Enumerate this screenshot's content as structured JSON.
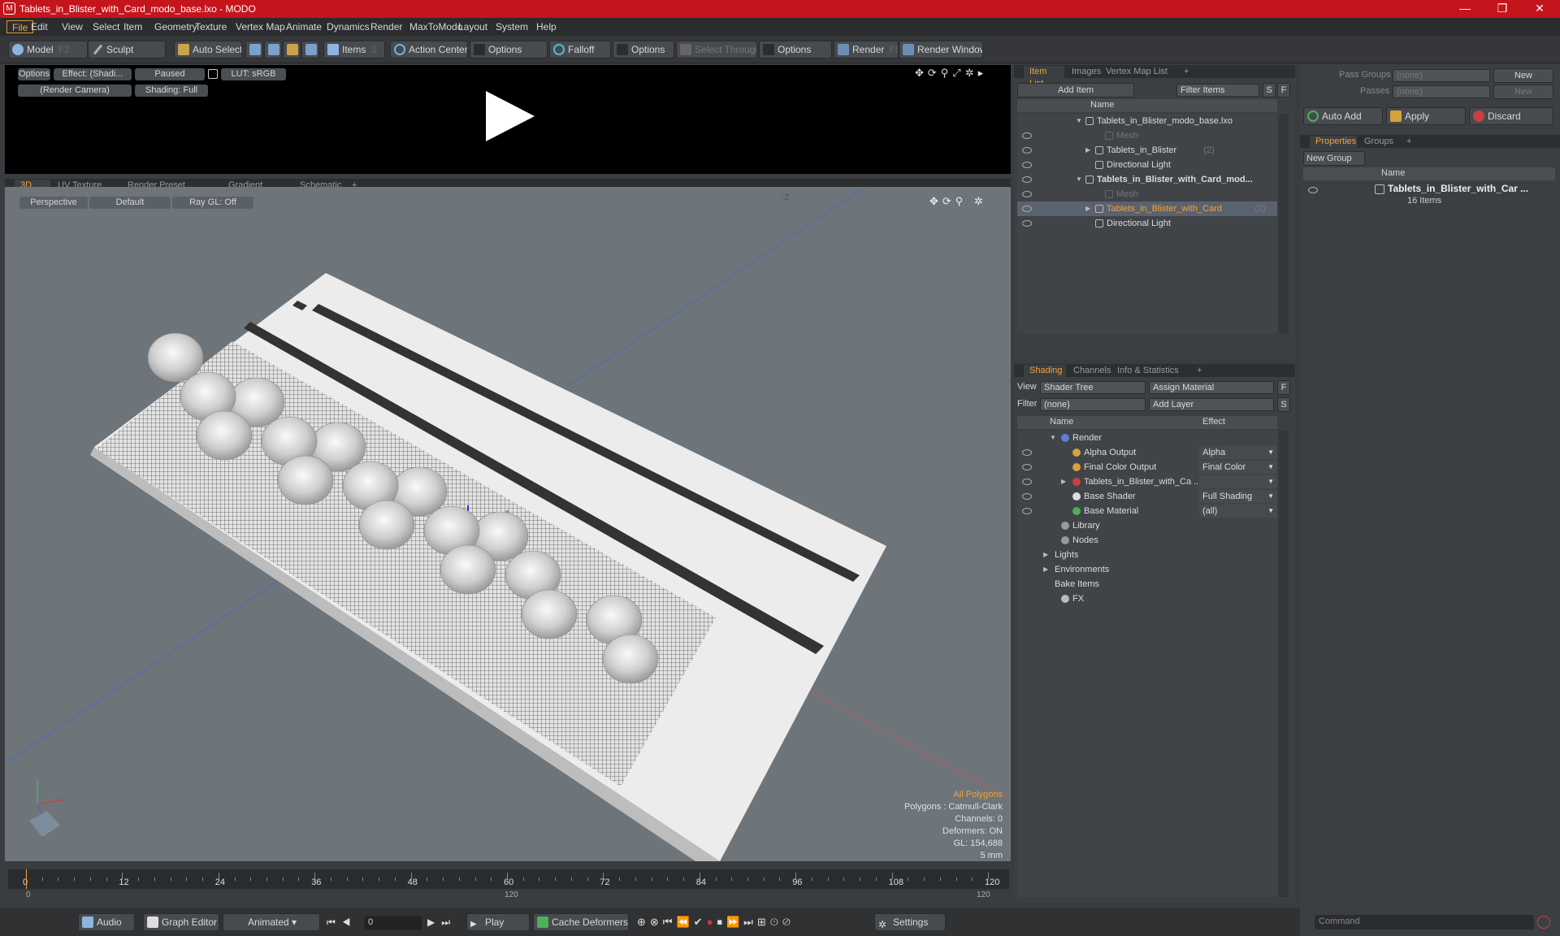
{
  "titlebar": {
    "title": "Tablets_in_Blister_with_Card_modo_base.lxo - MODO",
    "minimize": "—",
    "restore": "❐",
    "close": "✕"
  },
  "menu": [
    "File",
    "Edit",
    "View",
    "Select",
    "Item",
    "Geometry",
    "Texture",
    "Vertex Map",
    "Animate",
    "Dynamics",
    "Render",
    "MaxToModo",
    "Layout",
    "System",
    "Help"
  ],
  "toolbar": {
    "model": "Model",
    "model_key": "F2",
    "sculpt": "Sculpt",
    "auto_select": "Auto Select",
    "items": "Items",
    "items_key": "S",
    "action_center": "Action Center",
    "options1": "Options",
    "falloff": "Falloff",
    "options2": "Options",
    "select_through": "Select Through",
    "options3": "Options",
    "render": "Render",
    "render_key": "F9",
    "render_window": "Render Window"
  },
  "preview": {
    "options": "Options",
    "effect": "Effect: (Shadi...",
    "paused": "Paused",
    "lut": "LUT: sRGB",
    "camera": "(Render Camera)",
    "shading": "Shading: Full"
  },
  "view_tabs": [
    "3D View",
    "UV Texture View",
    "Render Preset Browser",
    "Gradient Editor",
    "Schematic",
    "+"
  ],
  "viewport": {
    "perspective": "Perspective",
    "default": "Default",
    "raygl": "Ray GL: Off",
    "axis_label": "-Z",
    "stats": {
      "all_polygons": "All Polygons",
      "polygons": "Polygons : Catmull-Clark",
      "channels": "Channels: 0",
      "deformers": "Deformers: ON",
      "gl": "GL: 154,688",
      "scale": "5 mm"
    }
  },
  "timeline": {
    "ticks": [
      "0",
      "12",
      "24",
      "36",
      "48",
      "60",
      "72",
      "84",
      "96",
      "108",
      "120"
    ],
    "start": "0",
    "mid": "120",
    "end": "120"
  },
  "bottom": {
    "audio": "Audio",
    "graph_editor": "Graph Editor",
    "animated": "Animated",
    "frame": "0",
    "play": "Play",
    "cache": "Cache Deformers",
    "settings": "Settings"
  },
  "itemlist": {
    "tabs": [
      "Item List",
      "Images",
      "Vertex Map List",
      "+"
    ],
    "add_item": "Add Item",
    "filter": "Filter Items",
    "s": "S",
    "f": "F",
    "col_name": "Name",
    "rows": [
      {
        "label": "Tablets_in_Blister_modo_base.lxo",
        "indent": 0,
        "bold": false,
        "dim": false,
        "sel": false,
        "eye": false,
        "arrow": "▼"
      },
      {
        "label": "Mesh",
        "indent": 2,
        "bold": false,
        "dim": true,
        "sel": false,
        "eye": true,
        "arrow": ""
      },
      {
        "label": "Tablets_in_Blister",
        "count": "(2)",
        "indent": 1,
        "bold": false,
        "dim": false,
        "sel": false,
        "eye": true,
        "arrow": "▶"
      },
      {
        "label": "Directional Light",
        "indent": 1,
        "bold": false,
        "dim": false,
        "sel": false,
        "eye": true,
        "arrow": ""
      },
      {
        "label": "Tablets_in_Blister_with_Card_mod...",
        "indent": 0,
        "bold": true,
        "dim": false,
        "sel": false,
        "eye": true,
        "arrow": "▼"
      },
      {
        "label": "Mesh",
        "indent": 2,
        "bold": false,
        "dim": true,
        "sel": false,
        "eye": true,
        "arrow": ""
      },
      {
        "label": "Tablets_in_Blister_with_Card",
        "count": "(2)",
        "indent": 1,
        "bold": false,
        "dim": false,
        "sel": true,
        "eye": true,
        "arrow": "▶"
      },
      {
        "label": "Directional Light",
        "indent": 1,
        "bold": false,
        "dim": false,
        "sel": false,
        "eye": true,
        "arrow": ""
      }
    ]
  },
  "shading": {
    "tabs": [
      "Shading",
      "Channels",
      "Info & Statistics",
      "+"
    ],
    "view_label": "View",
    "view_value": "Shader Tree",
    "assign": "Assign Material",
    "filter_label": "Filter",
    "filter_value": "(none)",
    "add_layer": "Add Layer",
    "f": "F",
    "s": "S",
    "col_name": "Name",
    "col_effect": "Effect",
    "rows": [
      {
        "label": "Render",
        "effect": "",
        "indent": 0,
        "eye": false,
        "arrow": "▼",
        "icon": "#5b7fd4"
      },
      {
        "label": "Alpha Output",
        "effect": "Alpha",
        "indent": 1,
        "eye": true,
        "arrow": "",
        "icon": "#d4a13a"
      },
      {
        "label": "Final Color Output",
        "effect": "Final Color",
        "indent": 1,
        "eye": true,
        "arrow": "",
        "icon": "#d4a13a"
      },
      {
        "label": "Tablets_in_Blister_with_Ca ...",
        "effect": "",
        "indent": 1,
        "eye": true,
        "arrow": "▶",
        "icon": "#c84040"
      },
      {
        "label": "Base Shader",
        "effect": "Full Shading",
        "indent": 1,
        "eye": true,
        "arrow": "",
        "icon": "#dcdcdc"
      },
      {
        "label": "Base Material",
        "effect": "(all)",
        "indent": 1,
        "eye": true,
        "arrow": "",
        "icon": "#4fae5a"
      },
      {
        "label": "Library",
        "effect": "",
        "indent": 0,
        "eye": false,
        "arrow": "",
        "icon": "#999"
      },
      {
        "label": "Nodes",
        "effect": "",
        "indent": 0,
        "eye": false,
        "arrow": "",
        "icon": "#999"
      },
      {
        "label": "Lights",
        "effect": "",
        "indent": -1,
        "eye": false,
        "arrow": "▶",
        "icon": ""
      },
      {
        "label": "Environments",
        "effect": "",
        "indent": -1,
        "eye": false,
        "arrow": "▶",
        "icon": ""
      },
      {
        "label": "Bake Items",
        "effect": "",
        "indent": -1,
        "eye": false,
        "arrow": "",
        "icon": ""
      },
      {
        "label": "FX",
        "effect": "",
        "indent": 0,
        "eye": false,
        "arrow": "",
        "icon": "#bbb"
      }
    ]
  },
  "groups": {
    "pass_groups": "Pass Groups",
    "passes": "Passes",
    "none": "(none)",
    "new": "New",
    "auto_add": "Auto Add",
    "apply": "Apply",
    "discard": "Discard",
    "tabs": [
      "Properties",
      "Groups",
      "+"
    ],
    "new_group": "New Group",
    "col_name": "Name",
    "group_name": "Tablets_in_Blister_with_Car ...",
    "group_count": "16 Items",
    "command": "Command"
  }
}
